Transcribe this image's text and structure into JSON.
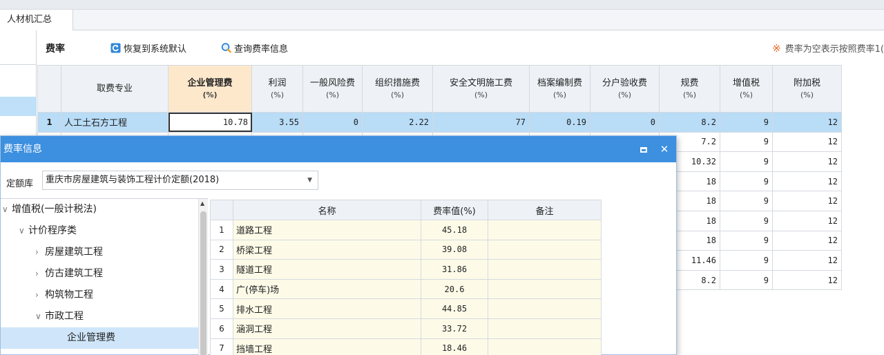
{
  "tabs": [
    {
      "label": "人材机汇总"
    }
  ],
  "toolbar": {
    "title": "费率",
    "restore_label": "恢复到系统默认",
    "query_label": "查询费率信息",
    "note": "费率为空表示按照费率1("
  },
  "grid": {
    "headers": [
      {
        "label": "",
        "unit": ""
      },
      {
        "label": "取费专业",
        "unit": ""
      },
      {
        "label": "企业管理费",
        "unit": "(%)"
      },
      {
        "label": "利润",
        "unit": "(%)"
      },
      {
        "label": "一般风险费",
        "unit": "(%)"
      },
      {
        "label": "组织措施费",
        "unit": "(%)"
      },
      {
        "label": "安全文明施工费",
        "unit": "(%)"
      },
      {
        "label": "档案编制费",
        "unit": "(%)"
      },
      {
        "label": "分户验收费",
        "unit": "(%)"
      },
      {
        "label": "规费",
        "unit": "(%)"
      },
      {
        "label": "增值税",
        "unit": "(%)"
      },
      {
        "label": "附加税",
        "unit": "(%)"
      }
    ],
    "rows": [
      {
        "index": "1",
        "name": "人工土石方工程",
        "mgmt": "10.78",
        "profit": "3.55",
        "risk": "0",
        "org": "2.22",
        "safety": "77",
        "archive": "0.19",
        "accept": "0",
        "fee": "8.2",
        "vat": "9",
        "addtax": "12"
      },
      {
        "fee": "7.2",
        "vat": "9",
        "addtax": "12"
      },
      {
        "fee": "10.32",
        "vat": "9",
        "addtax": "12"
      },
      {
        "fee": "18",
        "vat": "9",
        "addtax": "12"
      },
      {
        "fee": "18",
        "vat": "9",
        "addtax": "12"
      },
      {
        "fee": "18",
        "vat": "9",
        "addtax": "12"
      },
      {
        "fee": "18",
        "vat": "9",
        "addtax": "12"
      },
      {
        "fee": "11.46",
        "vat": "9",
        "addtax": "12"
      },
      {
        "fee": "8.2",
        "vat": "9",
        "addtax": "12"
      }
    ]
  },
  "dialog": {
    "title": "费率信息",
    "close_symbol": "✕",
    "library_label": "定额库",
    "library_value": "重庆市房屋建筑与装饰工程计价定额(2018)",
    "tree": [
      {
        "label": "增值税(一般计税法)",
        "chev": "∨"
      },
      {
        "label": "计价程序类",
        "chev": "∨"
      },
      {
        "label": "房屋建筑工程",
        "chev": "›"
      },
      {
        "label": "仿古建筑工程",
        "chev": "›"
      },
      {
        "label": "构筑物工程",
        "chev": "›"
      },
      {
        "label": "市政工程",
        "chev": "∨"
      },
      {
        "label": "企业管理费",
        "chev": ""
      }
    ],
    "rate_headers": [
      "",
      "名称",
      "费率值(%)",
      "备注"
    ],
    "rates": [
      {
        "index": "1",
        "name": "道路工程",
        "value": "45.18",
        "remark": ""
      },
      {
        "index": "2",
        "name": "桥梁工程",
        "value": "39.08",
        "remark": ""
      },
      {
        "index": "3",
        "name": "隧道工程",
        "value": "31.86",
        "remark": ""
      },
      {
        "index": "4",
        "name": "广(停车)场",
        "value": "20.6",
        "remark": ""
      },
      {
        "index": "5",
        "name": "排水工程",
        "value": "44.85",
        "remark": ""
      },
      {
        "index": "6",
        "name": "涵洞工程",
        "value": "33.72",
        "remark": ""
      },
      {
        "index": "7",
        "name": "挡墙工程",
        "value": "18.46",
        "remark": ""
      }
    ]
  },
  "colors": {
    "accent": "#3d8fdf",
    "selection": "#b9dcf7",
    "highlight_header": "#fde8cc",
    "note_star": "#e8692a"
  },
  "icons": {
    "restore": "restore-icon",
    "query": "search-icon",
    "note": "asterisk-icon"
  }
}
